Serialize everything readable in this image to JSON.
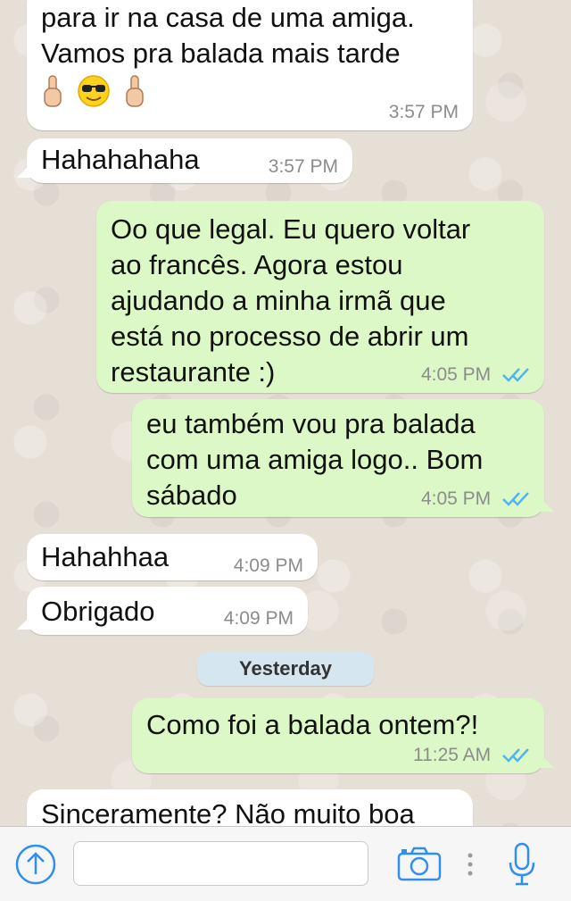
{
  "chat": {
    "messages": [
      {
        "direction": "incoming",
        "text": "para ir na casa de uma amiga.\nVamos pra balada mais tarde",
        "emojis": [
          "raised-index-finger",
          "sunglasses-face",
          "raised-index-finger"
        ],
        "time": "3:57 PM"
      },
      {
        "direction": "incoming",
        "text": "Hahahahaha",
        "time": "3:57 PM"
      },
      {
        "direction": "outgoing",
        "text": "Oo que legal. Eu quero voltar\nao francês.  Agora estou\najudando a minha irmã que\nestá no processo de abrir um\nrestaurante :)",
        "time": "4:05 PM",
        "status": "read"
      },
      {
        "direction": "outgoing",
        "text": "eu também vou pra balada\ncom uma amiga logo.. Bom\nsábado",
        "time": "4:05 PM",
        "status": "read"
      },
      {
        "direction": "incoming",
        "text": "Hahahhaa",
        "time": "4:09 PM"
      },
      {
        "direction": "incoming",
        "text": "Obrigado",
        "time": "4:09 PM"
      },
      {
        "direction": "outgoing",
        "text": "Como foi a balada ontem?!",
        "time": "11:25 AM",
        "status": "read"
      },
      {
        "direction": "incoming",
        "text": "Sinceramente? Não muito boa",
        "time": ""
      }
    ],
    "date_separator": "Yesterday"
  },
  "composer": {
    "input_value": "",
    "icons": [
      "share-arrow-icon",
      "camera-icon",
      "more-dots-icon",
      "microphone-icon"
    ]
  },
  "colors": {
    "incoming_bubble": "#ffffff",
    "outgoing_bubble": "#dcf8c6",
    "read_ticks": "#4fb3f6",
    "accent": "#2f8ef2",
    "date_pill": "#d6e6f1"
  }
}
